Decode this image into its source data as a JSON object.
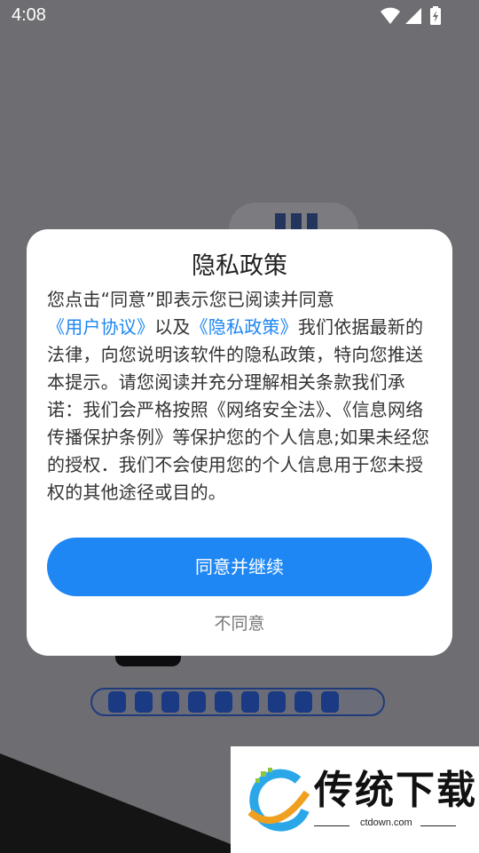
{
  "status_bar": {
    "time": "4:08",
    "icons": [
      "wifi-icon",
      "signal-icon",
      "battery-charging-icon"
    ]
  },
  "dialog": {
    "title": "隐私政策",
    "body_text_1": "您点击“同意”即表示您已阅读并同意",
    "link_user_agreement": "《用户协议》",
    "body_text_2": "以及",
    "link_privacy_policy": "《隐私政策》",
    "body_text_3": "我们依据最新的法律，向您说明该软件的隐私政策，特向您推送本提示。请您阅读并充分理解相关条款我们承诺：我们会严格按照《网络安全法》、《信息网络传播保护条例》等保护您的个人信息;如果未经您的授权．我们不会使用您的个人信息用于您未授权的其他途径或目的。",
    "agree_label": "同意并继续",
    "disagree_label": "不同意"
  },
  "watermark": {
    "brand": "传统下载",
    "url": "ctdown.com"
  },
  "colors": {
    "overlay": "#6e6e72",
    "accent": "#1f87f4",
    "link": "#1d86f2"
  }
}
